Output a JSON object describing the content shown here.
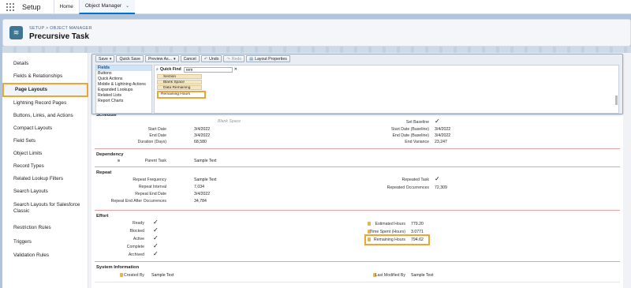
{
  "topbar": {
    "app_name": "Setup",
    "tabs": [
      "Home",
      "Object Manager"
    ]
  },
  "header": {
    "breadcrumb": "SETUP > OBJECT MANAGER",
    "title": "Precursive Task"
  },
  "sidebar": {
    "items": [
      "Details",
      "Fields & Relationships",
      "Page Layouts",
      "Lightning Record Pages",
      "Buttons, Links, and Actions",
      "Compact Layouts",
      "Field Sets",
      "Object Limits",
      "Record Types",
      "Related Lookup Filters",
      "Search Layouts",
      "Search Layouts for Salesforce Classic",
      "Restriction Rules",
      "Triggers",
      "Validation Rules"
    ]
  },
  "toolbar": {
    "save": "Save",
    "quick_save": "Quick Save",
    "preview": "Preview As...",
    "cancel": "Cancel",
    "undo": "Undo",
    "redo": "Redo",
    "layout_props": "Layout Properties"
  },
  "palette": {
    "categories": [
      "Fields",
      "Buttons",
      "Quick Actions",
      "Mobile & Lightning Actions",
      "Expanded Lookups",
      "Related Lists",
      "Report Charts"
    ],
    "quick_find_label": "Quick Find",
    "quick_find_value": "rem",
    "fields": [
      "Section",
      "Blank Space",
      "Data Remaining",
      "Remaining Hours"
    ]
  },
  "schedule": {
    "title": "Schedule",
    "blank_space": "Blank Space",
    "left": [
      [
        "Start Date",
        "3/4/2022"
      ],
      [
        "End Date",
        "3/4/2022"
      ],
      [
        "Duration (Days)",
        "68,580"
      ]
    ],
    "right": [
      [
        "Set Baseline",
        ""
      ],
      [
        "Start Date (Baseline)",
        "3/4/2022"
      ],
      [
        "End Date (Baseline)",
        "3/4/2022"
      ],
      [
        "End Variance",
        "23,247"
      ]
    ]
  },
  "dependency": {
    "title": "Dependency",
    "parent_label": "Parent Task",
    "parent_value": "Sample Text"
  },
  "repeat": {
    "title": "Repeat",
    "left": [
      [
        "Repeat Frequency",
        "Sample Text"
      ],
      [
        "Repeat Interval",
        "7,034"
      ],
      [
        "Repeat End Date",
        "3/4/2022"
      ],
      [
        "Repeat End After Occurrences",
        "34,784"
      ]
    ],
    "right": [
      [
        "Repeated Task",
        ""
      ],
      [
        "Repeated Occurrences",
        "72,309"
      ]
    ]
  },
  "effort": {
    "title": "Effort",
    "left": [
      "Ready",
      "Blocked",
      "Active",
      "Complete",
      "Archived"
    ],
    "right": [
      [
        "Estimated Hours",
        "779.20"
      ],
      [
        "Time Spent (Hours)",
        "3.0771"
      ],
      [
        "Remaining Hours",
        "794.62"
      ]
    ]
  },
  "system": {
    "title": "System Information",
    "created_label": "Created By",
    "created_value": "Sample Text",
    "modified_label": "Last Modified By",
    "modified_value": "Sample Text"
  },
  "colors": {
    "highlight": "#f0a431",
    "section_line": "#e8a0a0",
    "brand_blue": "#0070d2"
  }
}
